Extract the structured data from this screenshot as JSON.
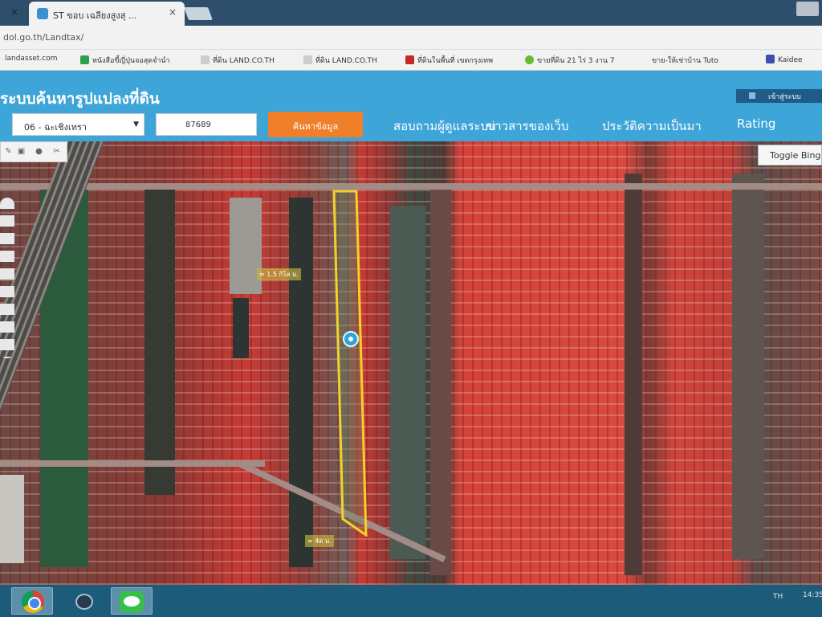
{
  "browser": {
    "tab_title": "ST ขอบ เฉลียงสูงสุ ...",
    "tab_close": "×",
    "left_close": "×",
    "url": "dol.go.th/Landtax/",
    "bookmarks": [
      {
        "label": "landasset.com",
        "icon_color": "#ffffff"
      },
      {
        "label": "หนังสือขี้ญี่ปุ่นจอสุดจำนำ",
        "icon_color": "#2ca04a"
      },
      {
        "label": "ที่ดิน LAND.CO.TH",
        "icon_color": "#cccccc"
      },
      {
        "label": "ที่ดิน LAND.CO.TH",
        "icon_color": "#cccccc"
      },
      {
        "label": "ที่ดินในพื้นที่ เขตกรุงเทพ",
        "icon_color": "#c62828"
      },
      {
        "label": "ขายที่ดิน 21 ไร่ 3 งาน 7",
        "icon_color": "#66bb33"
      },
      {
        "label": "ขาย-ให้เช่าบ้าน Tuto",
        "icon_color": "#888888"
      },
      {
        "label": "Kaidee",
        "icon_color": "#3a4fb0"
      }
    ]
  },
  "app": {
    "title": "ระบบค้นหารูปแปลงที่ดิน",
    "top_right_label": "เข้าสู่ระบบ",
    "province_select": "06 - ฉะเชิงเทรา",
    "province_caret": "▼",
    "parcel_number": "87689",
    "search_button": "ค้นหาข้อมูล",
    "nav": [
      "สอบถามผู้ดูแลระบบ",
      "ข่าวสารของเว็บ",
      "ประวัติความเป็นมา",
      "Rating"
    ]
  },
  "map": {
    "tools": [
      "✎",
      "▣",
      "●",
      "✂"
    ],
    "toggle_label": "Toggle Bing",
    "label_top": "≈ 1.5 กิโล ม.",
    "label_bottom": "≈ 4ด ม."
  },
  "taskbar": {
    "tray_lang": "TH",
    "tray_clock": "14:35"
  },
  "colors": {
    "header_bg": "#3ea5d9",
    "search_button": "#f07f2a",
    "plot_outline": "#f2d22a",
    "taskbar": "#1d5b7a"
  }
}
